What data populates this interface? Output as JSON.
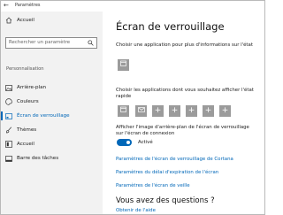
{
  "titlebar": {
    "back_icon": "back-arrow-icon",
    "title": "Paramètres"
  },
  "sidebar": {
    "home": {
      "label": "Accueil",
      "icon": "home-icon"
    },
    "search": {
      "placeholder": "Rechercher un paramètre",
      "icon": "search-icon"
    },
    "section": "Personnalisation",
    "items": [
      {
        "label": "Arrière-plan",
        "icon": "image-icon"
      },
      {
        "label": "Couleurs",
        "icon": "palette-icon"
      },
      {
        "label": "Écran de verrouillage",
        "icon": "lock-screen-icon",
        "selected": true
      },
      {
        "label": "Thèmes",
        "icon": "brush-icon"
      },
      {
        "label": "Accueil",
        "icon": "start-icon"
      },
      {
        "label": "Barre des tâches",
        "icon": "taskbar-icon"
      }
    ]
  },
  "main": {
    "title": "Écran de verrouillage",
    "detailed_status_label": "Choisir une application pour plus d'informations sur l'état",
    "quick_status_label": "Choisir les applications dont vous souhaitez afficher l'état rapide",
    "show_background_label": "Afficher l'image d'arrière-plan de l'écran de verrouillage sur l'écran de connexion",
    "toggle_state": "Activé",
    "links": [
      "Paramètres de l'écran de verrouillage de Cortana",
      "Paramètres du délai d'expiration de l'écran",
      "Paramètres de l'écran de veille"
    ],
    "questions_heading": "Vous avez des questions ?",
    "help_link": "Obtenir de l'aide",
    "plus": "+",
    "accent": "#0067b8"
  }
}
